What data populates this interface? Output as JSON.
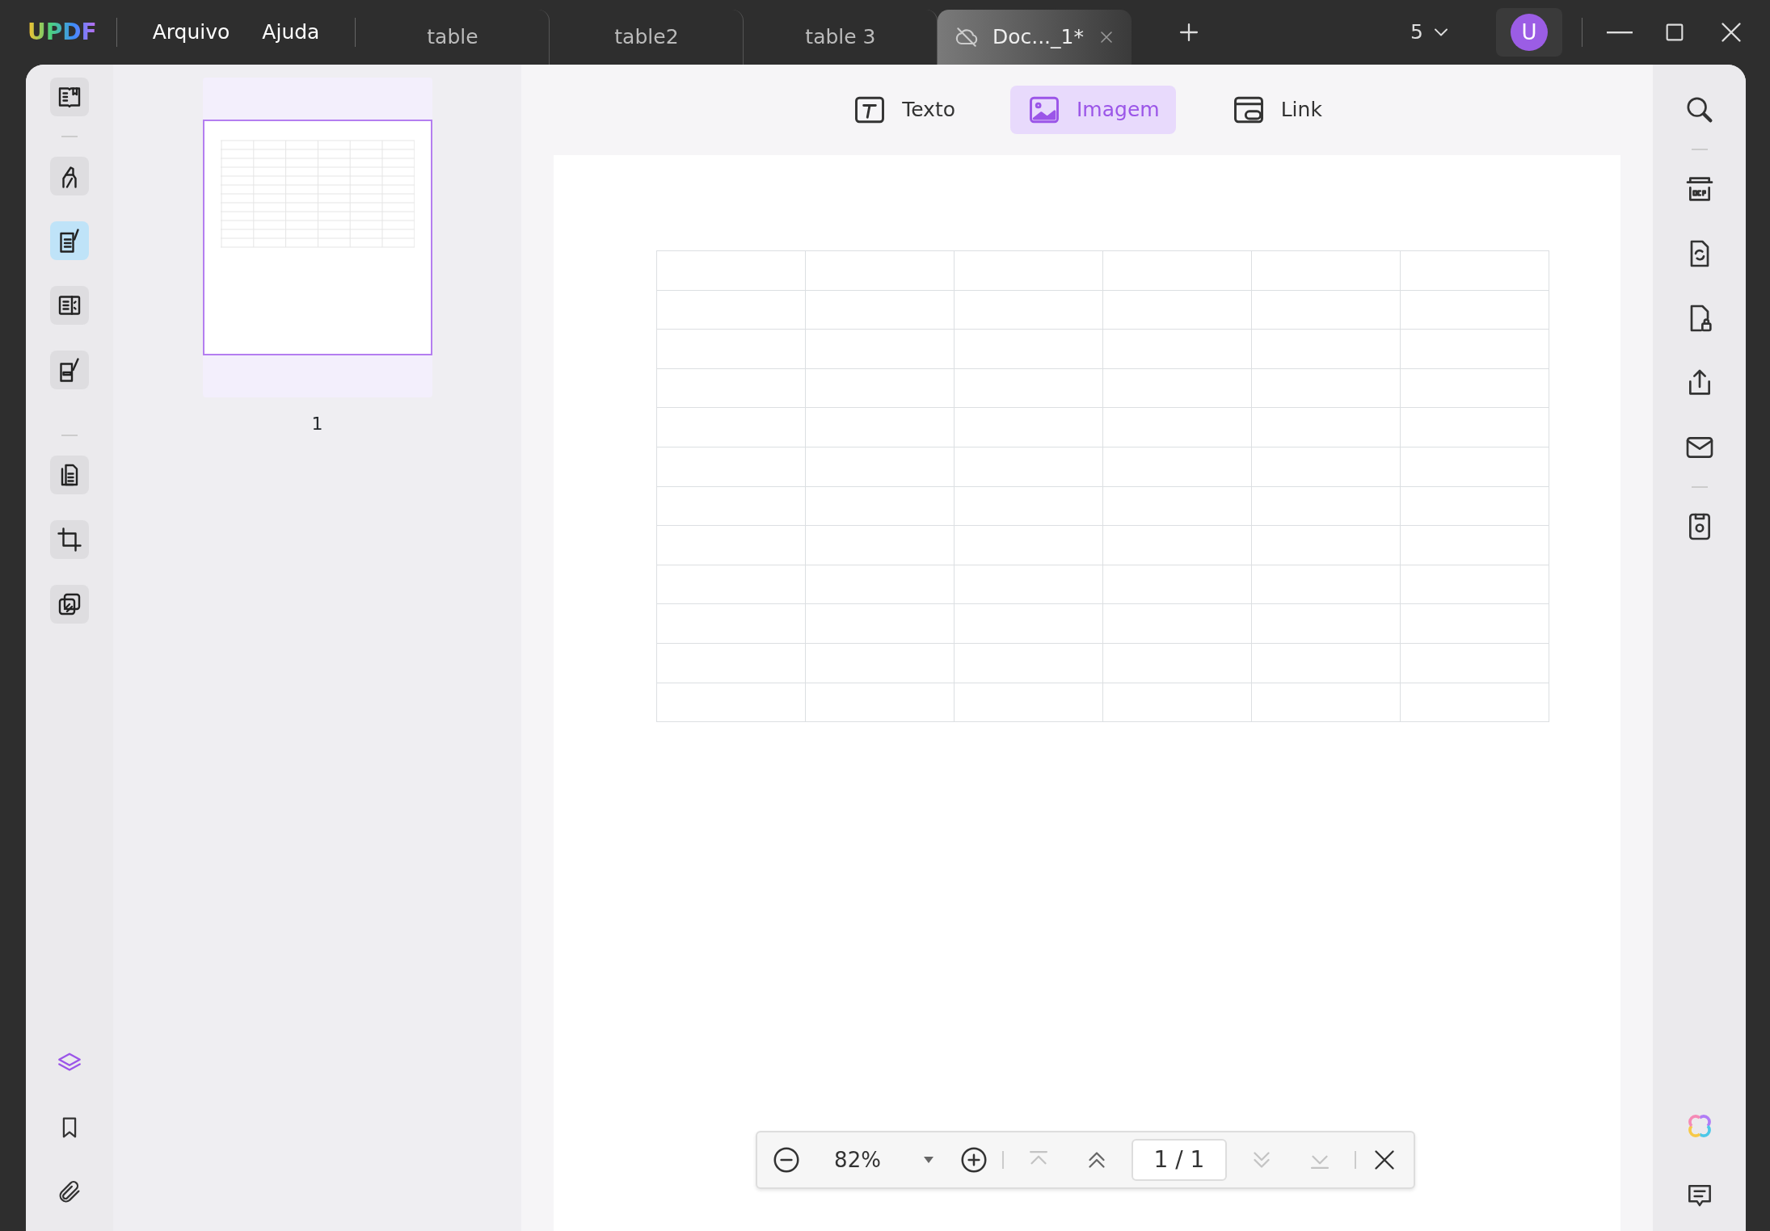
{
  "app": {
    "logo": "UPDF"
  },
  "menu": [
    "Arquivo",
    "Ajuda"
  ],
  "tabs": [
    {
      "label": "table",
      "selected": false
    },
    {
      "label": "table2",
      "selected": false
    },
    {
      "label": "table 3",
      "selected": false
    },
    {
      "label": "Doc..._1*",
      "selected": true
    }
  ],
  "window_count": "5",
  "avatar": "U",
  "left_toolbar": [
    {
      "selected": false
    },
    {
      "selected": false
    },
    {
      "selected": true
    },
    {
      "selected": false
    },
    {
      "selected": false
    },
    {
      "selected": false
    },
    {
      "selected": false
    },
    {
      "selected": false
    }
  ],
  "left_toolbar_bottom": [
    {
      "selected": true
    },
    {
      "selected": false
    },
    {
      "selected": false
    }
  ],
  "thumbnails": [
    {
      "label": "1",
      "selected": true
    }
  ],
  "edit_toolbar": [
    {
      "label": "Texto",
      "selected": false
    },
    {
      "label": "Imagem",
      "selected": true
    },
    {
      "label": "Link",
      "selected": false
    }
  ],
  "zoom_bar": {
    "zoom": "82%",
    "page": "1 / 1",
    "nav": [
      {
        "disabled": true
      },
      {
        "disabled": false
      },
      {
        "disabled": true
      },
      {
        "disabled": true
      }
    ]
  }
}
